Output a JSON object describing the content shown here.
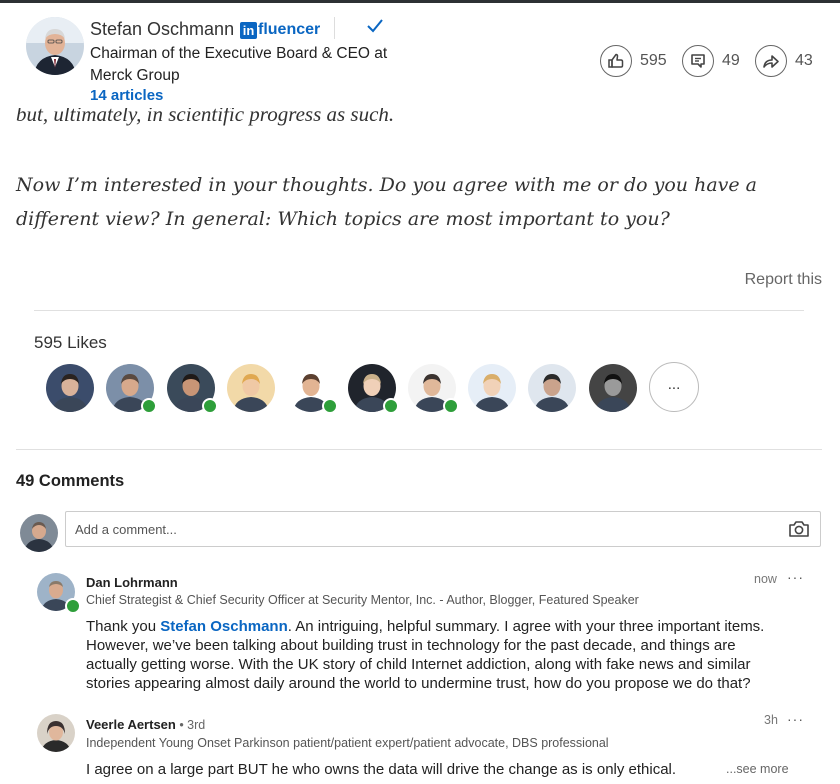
{
  "header": {
    "author_name": "Stefan Oschmann",
    "influencer_label": "fluencer",
    "title_line1": "Chairman of the Executive Board & CEO at",
    "title_line2": "Merck Group",
    "articles_link": "14 articles",
    "stats": {
      "likes": "595",
      "comments": "49",
      "shares": "43"
    }
  },
  "article": {
    "cut_text": "but, ultimately, in scientific progress as such.",
    "closing_line1": "Now I’m interested in your thoughts. Do you agree with me or do you have a",
    "closing_line2": "different view? In general: Which topics are most important to you?",
    "report_link": "Report this"
  },
  "likes": {
    "label": "595 Likes",
    "more_label": "...",
    "likers": [
      {
        "icon": "liker-avatar",
        "online": false,
        "bg": "#3b4c6b",
        "skin": "#d9b29a",
        "hair": "#2a2320"
      },
      {
        "icon": "liker-avatar",
        "online": true,
        "bg": "#7c8fa8",
        "skin": "#d7a98c",
        "hair": "#5a4a40"
      },
      {
        "icon": "liker-avatar",
        "online": true,
        "bg": "#3a4a5a",
        "skin": "#c89576",
        "hair": "#1f1a18"
      },
      {
        "icon": "liker-avatar",
        "online": false,
        "bg": "#f2d9a8",
        "skin": "#f0c9a5",
        "hair": "#e0a850"
      },
      {
        "icon": "liker-avatar",
        "online": true,
        "bg": "#ffffff",
        "skin": "#e2b493",
        "hair": "#5b4030"
      },
      {
        "icon": "liker-avatar",
        "online": true,
        "bg": "#20242c",
        "skin": "#f0d0b8",
        "hair": "#c9b08a"
      },
      {
        "icon": "liker-avatar",
        "online": true,
        "bg": "#f3f3f3",
        "skin": "#e0b89a",
        "hair": "#3b3330"
      },
      {
        "icon": "liker-avatar",
        "online": false,
        "bg": "#e6eef7",
        "skin": "#f1d2b8",
        "hair": "#d9ae6a"
      },
      {
        "icon": "liker-avatar",
        "online": false,
        "bg": "#dfe6ee",
        "skin": "#caa38c",
        "hair": "#2a2a2a"
      },
      {
        "icon": "liker-avatar",
        "online": false,
        "bg": "#444444",
        "skin": "#9a9a9a",
        "hair": "#111111"
      }
    ]
  },
  "comments": {
    "heading": "49 Comments",
    "input_placeholder": "Add a comment...",
    "items": [
      {
        "name": "Dan Lohrmann",
        "degree": "",
        "headline": "Chief Strategist & Chief Security Officer at Security Mentor, Inc. - Author, Blogger, Featured Speaker",
        "time": "now",
        "menu": "···",
        "body_prefix": "Thank you ",
        "mention": "Stefan Oschmann",
        "body_line1_rest": ". An intriguing, helpful summary. I agree with your three important items.",
        "body_line2": "However, we’ve been talking about building trust in technology for the past decade, and things are",
        "body_line3": "actually getting worse. With the UK story of child Internet addiction, along with fake news and similar",
        "body_line4": "stories appearing almost daily around the world to undermine trust, how do you propose we do that?"
      },
      {
        "name": "Veerle Aertsen",
        "degree": " • 3rd",
        "headline": "Independent Young Onset Parkinson patient/patient expert/patient advocate, DBS professional",
        "time": "3h",
        "menu": "···",
        "body_line1": "I agree on a large part BUT he who owns the data will drive the change as is only ethical.",
        "see_more": "...see more"
      }
    ]
  },
  "colors": {
    "brand_blue": "#0a66c2",
    "online_green": "#2e9e3a"
  }
}
